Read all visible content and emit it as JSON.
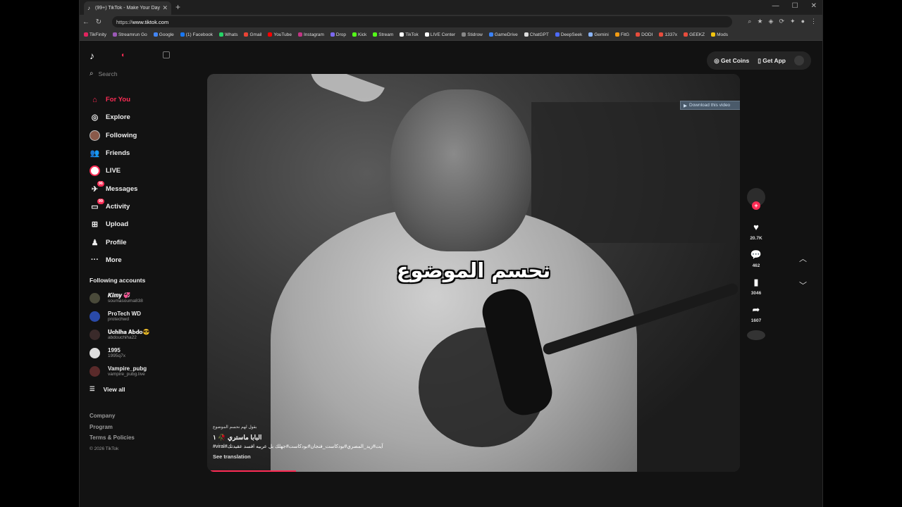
{
  "browser": {
    "tab_title": "(99+) TikTok - Make Your Day",
    "url_prefix": "https://",
    "url_host": "www.tiktok.com",
    "bookmarks": [
      {
        "label": "TikFinity",
        "color": "#e0245e"
      },
      {
        "label": "Streamrun Go",
        "color": "#9b59b6"
      },
      {
        "label": "Google",
        "color": "#4285f4"
      },
      {
        "label": "(1) Facebook",
        "color": "#1877f2"
      },
      {
        "label": "Whats",
        "color": "#25d366"
      },
      {
        "label": "Gmail",
        "color": "#ea4335"
      },
      {
        "label": "YouTube",
        "color": "#ff0000"
      },
      {
        "label": "Instagram",
        "color": "#c13584"
      },
      {
        "label": "Drop",
        "color": "#7b68ee"
      },
      {
        "label": "Kick",
        "color": "#53fc18"
      },
      {
        "label": "Stream",
        "color": "#53fc18"
      },
      {
        "label": "TikTok",
        "color": "#ffffff"
      },
      {
        "label": "LIVE Center",
        "color": "#ffffff"
      },
      {
        "label": "Stidrow",
        "color": "#888888"
      },
      {
        "label": "GameDrive",
        "color": "#3b82f6"
      },
      {
        "label": "ChatGPT",
        "color": "#dddddd"
      },
      {
        "label": "DeepSeek",
        "color": "#4d6bfe"
      },
      {
        "label": "Gemini",
        "color": "#8ab4f8"
      },
      {
        "label": "FitG",
        "color": "#f39c12"
      },
      {
        "label": "DODI",
        "color": "#e74c3c"
      },
      {
        "label": "1337x",
        "color": "#e74c3c"
      },
      {
        "label": "GEEKZ",
        "color": "#e74c3c"
      },
      {
        "label": "Mods",
        "color": "#f1c40f"
      }
    ]
  },
  "sidebar": {
    "search_placeholder": "Search",
    "nav": [
      {
        "label": "For You",
        "icon": "home-icon",
        "glyph": "⌂"
      },
      {
        "label": "Explore",
        "icon": "compass-icon",
        "glyph": "◎"
      },
      {
        "label": "Following",
        "icon": "following-avatar-icon",
        "glyph": ""
      },
      {
        "label": "Friends",
        "icon": "friends-icon",
        "glyph": "👥"
      },
      {
        "label": "LIVE",
        "icon": "live-icon",
        "glyph": ""
      },
      {
        "label": "Messages",
        "icon": "messages-icon",
        "glyph": "✈",
        "badge": "96"
      },
      {
        "label": "Activity",
        "icon": "activity-icon",
        "glyph": "▭",
        "badge": "99"
      },
      {
        "label": "Upload",
        "icon": "upload-icon",
        "glyph": "⊞"
      },
      {
        "label": "Profile",
        "icon": "profile-icon",
        "glyph": "♟"
      },
      {
        "label": "More",
        "icon": "more-icon",
        "glyph": "···"
      }
    ],
    "following_title": "Following accounts",
    "accounts": [
      {
        "name": "𝑲𝒊𝒎𝒚 💞",
        "handle": "soumasouma838",
        "color": "#4a4a3a"
      },
      {
        "name": "ProTech WD",
        "handle": "protechwd",
        "color": "#2a4aa8"
      },
      {
        "name": "𝐔𝐜𝐡𝐢𝐡𝐚 𝐀𝐛𝐝𝐨😎",
        "handle": "abdouchiha22",
        "color": "#3a2a2a"
      },
      {
        "name": "1995",
        "handle": "1995q7x",
        "color": "#dddddd"
      },
      {
        "name": "Vampire_pubg",
        "handle": "vampire_pubg.live",
        "color": "#5a2a2a"
      }
    ],
    "view_all": "View all",
    "footer": [
      "Company",
      "Program",
      "Terms & Policies"
    ],
    "copyright": "© 2026 TikTok"
  },
  "header": {
    "get_coins": "Get Coins",
    "get_app": "Get App"
  },
  "video": {
    "caption_overlay": "نحسم الموضوع",
    "download_button": "Download this video",
    "sound_text": "بقول لهم نحسم الموضوع",
    "author": "البابا ماستري 🥀 ١",
    "description": "#viral#آيت#زيد_المصري#بودكاست_فنجان#بودكاست#جهلك بل عربيه افسد عقيدتك",
    "see_translation": "See translation",
    "progress_fraction": 0.16
  },
  "actions": {
    "likes": "20.7K",
    "comments": "462",
    "saves": "3046",
    "shares": "1607"
  }
}
